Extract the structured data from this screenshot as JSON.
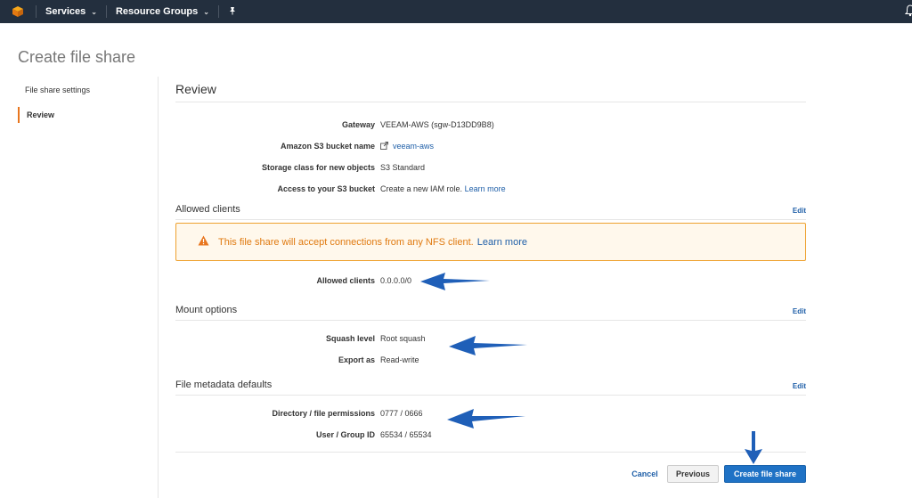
{
  "nav": {
    "services_label": "Services",
    "resource_groups_label": "Resource Groups"
  },
  "page": {
    "title": "Create file share"
  },
  "sidebar": {
    "items": [
      {
        "label": "File share settings",
        "active": false
      },
      {
        "label": "Review",
        "active": true
      }
    ]
  },
  "review": {
    "title": "Review",
    "gateway_label": "Gateway",
    "gateway_value": "VEEAM-AWS (sgw-D13DD9B8)",
    "bucket_label": "Amazon S3 bucket name",
    "bucket_value": "veeam-aws",
    "storage_label": "Storage class for new objects",
    "storage_value": "S3 Standard",
    "access_label": "Access to your S3 bucket",
    "access_value": "Create a new IAM role.",
    "access_link": "Learn more"
  },
  "allowed_clients": {
    "title": "Allowed clients",
    "edit": "Edit",
    "warning_text": "This file share will accept connections from any NFS client.",
    "warning_link": "Learn more",
    "label": "Allowed clients",
    "value": "0.0.0.0/0"
  },
  "mount_options": {
    "title": "Mount options",
    "edit": "Edit",
    "squash_label": "Squash level",
    "squash_value": "Root squash",
    "export_label": "Export as",
    "export_value": "Read-write"
  },
  "metadata": {
    "title": "File metadata defaults",
    "edit": "Edit",
    "perm_label": "Directory / file permissions",
    "perm_value": "0777 / 0666",
    "ugid_label": "User / Group ID",
    "ugid_value": "65534 / 65534"
  },
  "actions": {
    "cancel": "Cancel",
    "previous": "Previous",
    "create": "Create file share"
  },
  "colors": {
    "nav_bg": "#232f3e",
    "accent_orange": "#e8761f",
    "link_blue": "#1f5fa8",
    "primary_button": "#1f72c5",
    "annotation_arrow": "#1f5fb8"
  }
}
